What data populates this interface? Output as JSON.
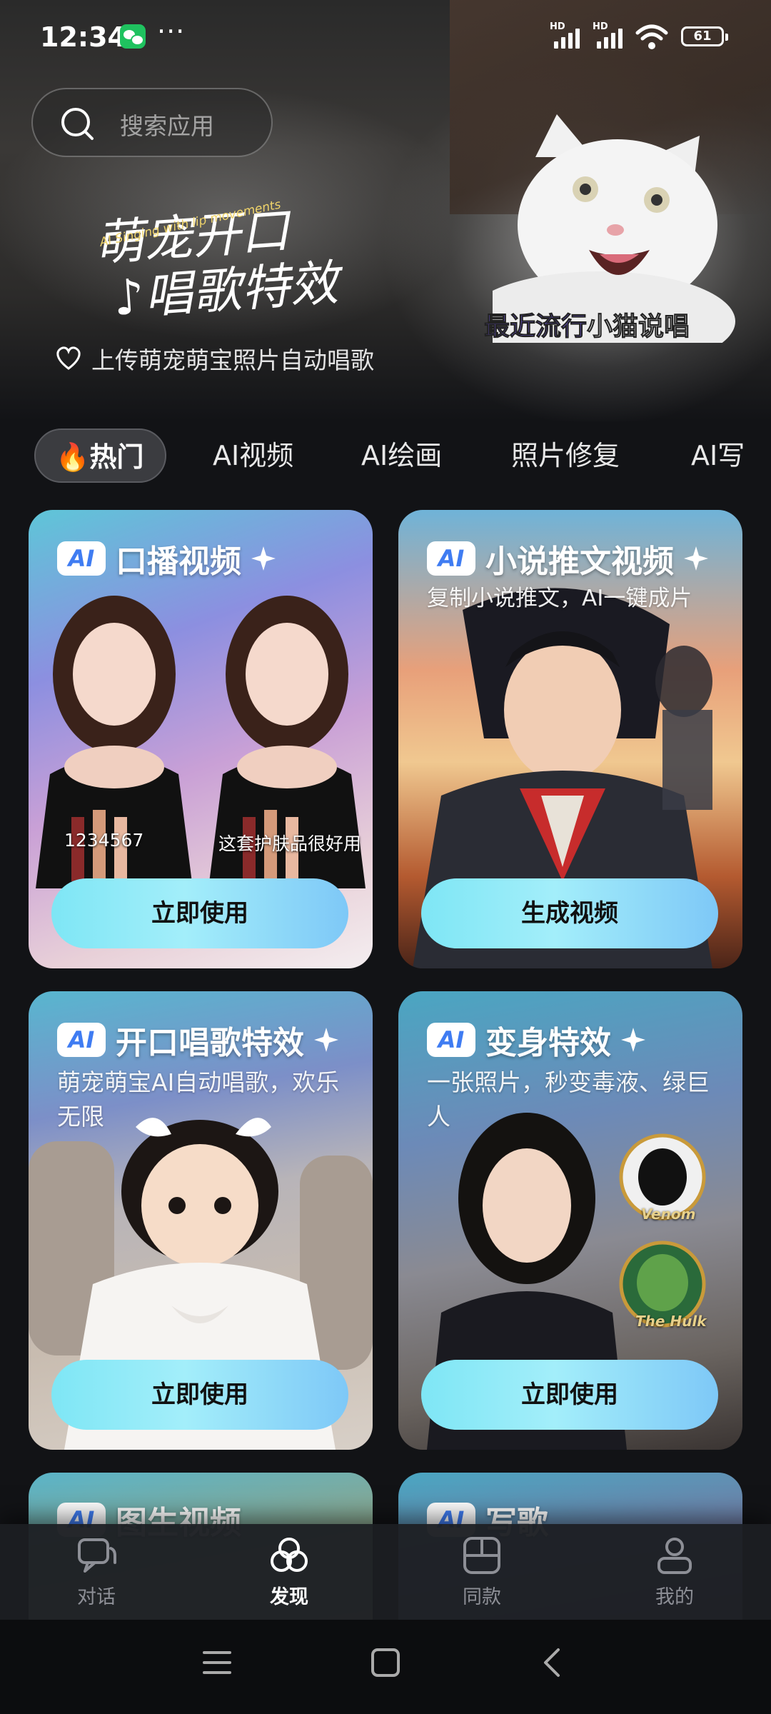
{
  "status_bar": {
    "time": "12:34",
    "more": "···",
    "signal_1_label": "HD",
    "signal_2_label": "HD",
    "battery": "61"
  },
  "search": {
    "placeholder": "搜索应用"
  },
  "hero": {
    "title_line1": "萌宠开口",
    "title_line2": "♪唱歌特效",
    "subtitle_en": "AI Singing with lip movements",
    "description": "上传萌宠萌宝照片自动唱歌",
    "tag_accent": "最近流行",
    "tag_text": "小猫说唱"
  },
  "category_tabs": [
    {
      "label": "🔥热门",
      "active": true
    },
    {
      "label": "AI视频",
      "active": false
    },
    {
      "label": "AI绘画",
      "active": false
    },
    {
      "label": "照片修复",
      "active": false
    },
    {
      "label": "AI写真",
      "active": false
    }
  ],
  "cards": [
    {
      "badge": "AI",
      "title": "口播视频",
      "description": "",
      "overlay_left": "1234567",
      "overlay_right": "这套护肤品很好用",
      "button": "立即使用"
    },
    {
      "badge": "AI",
      "title": "小说推文视频",
      "description": "复制小说推文，AI一键成片",
      "button": "生成视频"
    },
    {
      "badge": "AI",
      "title": "开口唱歌特效",
      "description": "萌宠萌宝AI自动唱歌，欢乐无限",
      "button": "立即使用"
    },
    {
      "badge": "AI",
      "title": "变身特效",
      "description": "一张照片，秒变毒液、绿巨人",
      "sticker_1": "Venom",
      "sticker_2": "The Hulk",
      "button": "立即使用"
    },
    {
      "badge": "AI",
      "title": "图生视频"
    },
    {
      "badge": "AI",
      "title": "写歌"
    }
  ],
  "bottom_nav": [
    {
      "label": "对话",
      "icon": "chat-icon",
      "active": false
    },
    {
      "label": "发现",
      "icon": "discover-icon",
      "active": true
    },
    {
      "label": "同款",
      "icon": "template-icon",
      "active": false
    },
    {
      "label": "我的",
      "icon": "profile-icon",
      "active": false
    }
  ],
  "colors": {
    "background": "#121316",
    "button_gradient_start": "#7ee6f5",
    "button_gradient_end": "#7ec8f7",
    "badge_blue": "#3f7cf2",
    "tag_accent": "#6c56d6"
  }
}
